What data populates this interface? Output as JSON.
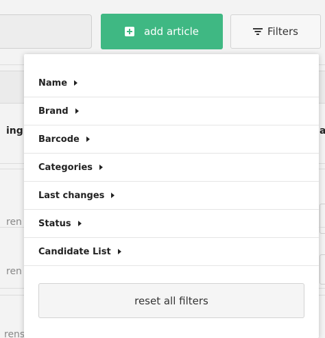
{
  "toolbar": {
    "add_article_label": "add article",
    "filters_label": "Filters"
  },
  "filter_menu": {
    "items": [
      {
        "label": "Name"
      },
      {
        "label": "Brand"
      },
      {
        "label": "Barcode"
      },
      {
        "label": "Categories"
      },
      {
        "label": "Last changes"
      },
      {
        "label": "Status"
      },
      {
        "label": "Candidate List"
      }
    ],
    "reset_label": "reset all filters"
  },
  "background": {
    "column_left_fragment": "ing",
    "column_right_fragment": "a",
    "row_fragments": [
      "ren",
      "ren",
      "rens"
    ]
  },
  "colors": {
    "accent": "#3fb883",
    "status_pink": "#e23a6b"
  },
  "icons": {
    "add": "plus-square-icon",
    "filter": "filter-lines-icon",
    "caret": "caret-right-icon"
  }
}
